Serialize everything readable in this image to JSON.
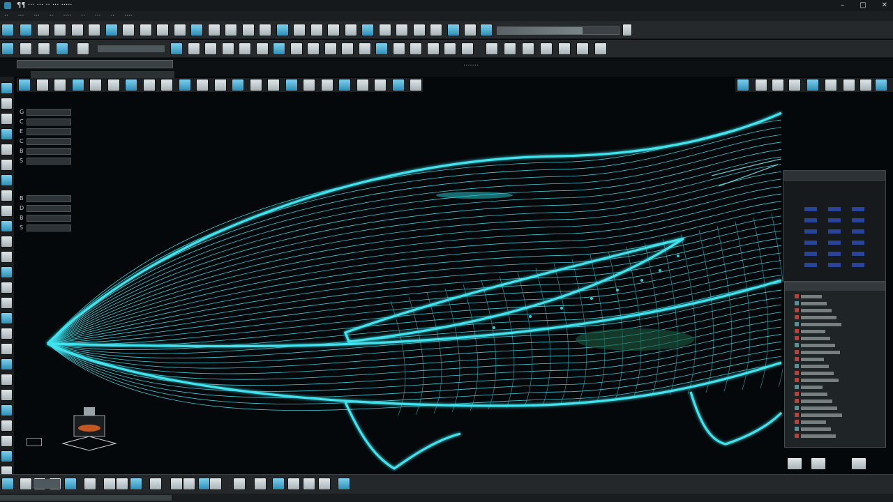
{
  "window": {
    "title": "¶¶ ··· ··· ·· ··· ·····",
    "controls": [
      "–",
      "□",
      "✕"
    ]
  },
  "menubar": {
    "items": [
      "··",
      "···",
      "···",
      "··",
      "····",
      "··",
      "···",
      "··",
      "····"
    ]
  },
  "viewport": {
    "title": "·······",
    "accent_color": "#3fe3ee",
    "background_color": "#05080a"
  },
  "properties_panel": {
    "group1_keys": [
      "G",
      "C",
      "E",
      "C",
      "B",
      "S"
    ],
    "group2_keys": [
      "B",
      "D",
      "B",
      "S"
    ]
  },
  "icons": {
    "toolbar": [
      "file-new-icon",
      "open-icon",
      "save-icon",
      "undo-icon",
      "redo-icon",
      "select-icon",
      "move-icon",
      "rotate-icon",
      "scale-icon",
      "curve-icon",
      "surface-icon",
      "loft-icon",
      "sweep-icon",
      "trim-icon",
      "extend-icon",
      "fillet-icon",
      "snap-icon",
      "layer-icon",
      "render-icon",
      "zoom-icon"
    ],
    "view": [
      "wireframe-icon",
      "shaded-icon",
      "rendered-icon",
      "perspective-icon",
      "top-view-icon",
      "front-view-icon",
      "right-view-icon"
    ]
  }
}
